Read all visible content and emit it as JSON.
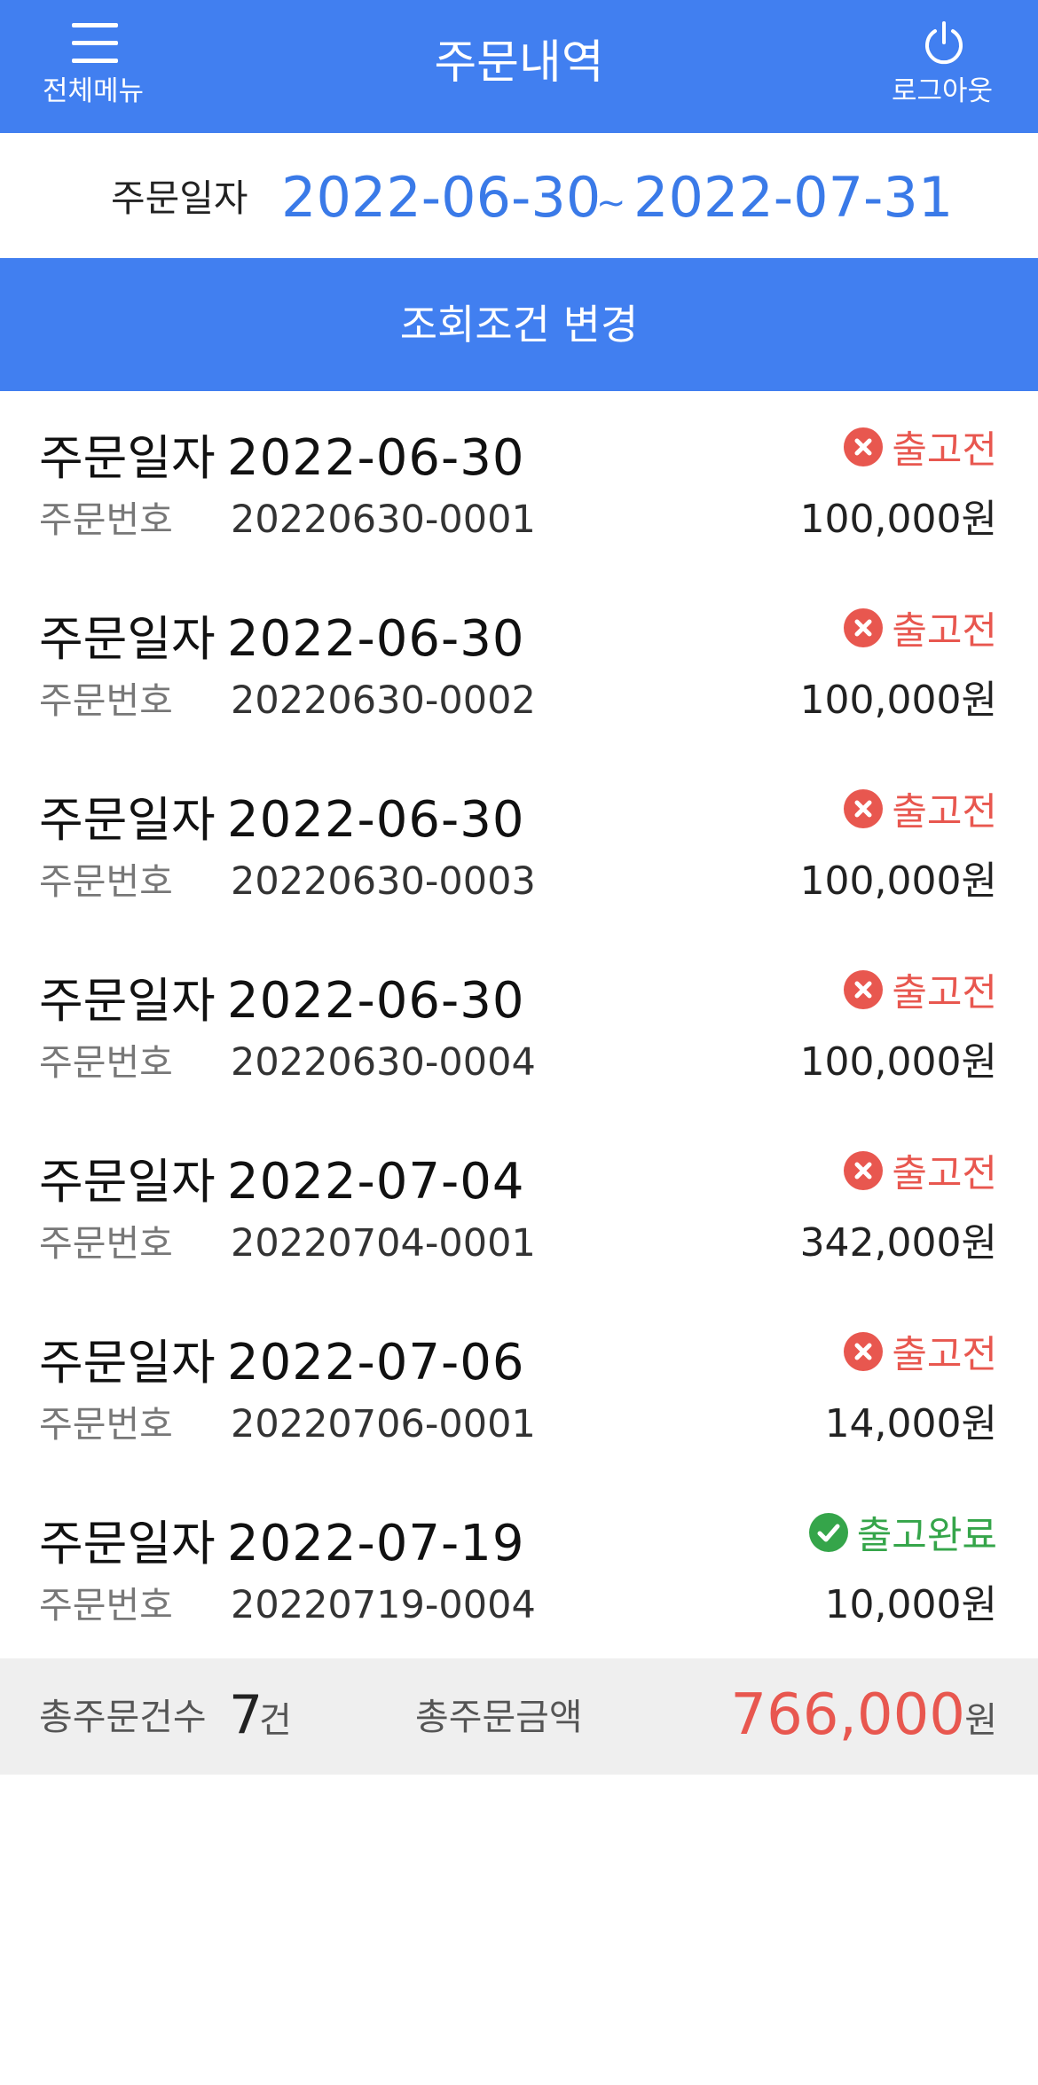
{
  "header": {
    "menu_label": "전체메뉴",
    "title": "주문내역",
    "logout_label": "로그아웃",
    "menu_icon": "hamburger-icon",
    "logout_icon": "power-icon"
  },
  "date_range": {
    "label": "주문일자",
    "start": "2022-06-30",
    "separator": "~",
    "end": "2022-07-31"
  },
  "change_button": {
    "label": "조회조건 변경"
  },
  "orders": [
    {
      "date_label": "주문일자",
      "date": "2022-06-30",
      "no_label": "주문번호",
      "order_no": "20220630-0001",
      "status": "출고전",
      "status_type": "pending",
      "amount": "100,000원"
    },
    {
      "date_label": "주문일자",
      "date": "2022-06-30",
      "no_label": "주문번호",
      "order_no": "20220630-0002",
      "status": "출고전",
      "status_type": "pending",
      "amount": "100,000원"
    },
    {
      "date_label": "주문일자",
      "date": "2022-06-30",
      "no_label": "주문번호",
      "order_no": "20220630-0003",
      "status": "출고전",
      "status_type": "pending",
      "amount": "100,000원"
    },
    {
      "date_label": "주문일자",
      "date": "2022-06-30",
      "no_label": "주문번호",
      "order_no": "20220630-0004",
      "status": "출고전",
      "status_type": "pending",
      "amount": "100,000원"
    },
    {
      "date_label": "주문일자",
      "date": "2022-07-04",
      "no_label": "주문번호",
      "order_no": "20220704-0001",
      "status": "출고전",
      "status_type": "pending",
      "amount": "342,000원"
    },
    {
      "date_label": "주문일자",
      "date": "2022-07-06",
      "no_label": "주문번호",
      "order_no": "20220706-0001",
      "status": "출고전",
      "status_type": "pending",
      "amount": "14,000원"
    },
    {
      "date_label": "주문일자",
      "date": "2022-07-19",
      "no_label": "주문번호",
      "order_no": "20220719-0004",
      "status": "출고완료",
      "status_type": "done",
      "amount": "10,000원"
    }
  ],
  "summary": {
    "count_label": "총주문건수",
    "count": "7",
    "count_unit": "건",
    "amount_label": "총주문금액",
    "amount": "766,000",
    "amount_unit": "원"
  },
  "colors": {
    "primary": "#417ff0",
    "date_blue": "#3a7ae8",
    "pending_red": "#e8574f",
    "done_green": "#35a54a",
    "summary_bg": "#efefef"
  }
}
